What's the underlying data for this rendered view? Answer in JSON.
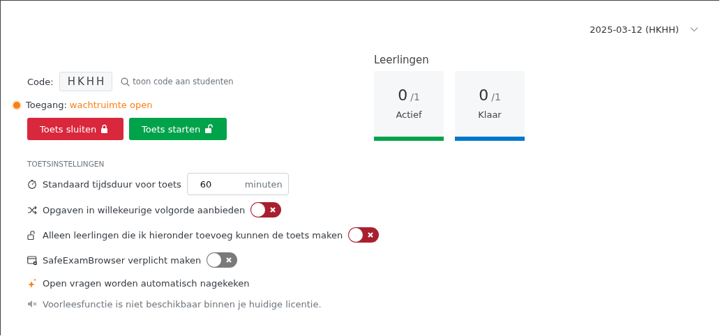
{
  "session_select": {
    "value": "2025-03-12 (HKHH)"
  },
  "code": {
    "label": "Code:",
    "value": "HKHH",
    "show_link": "toon code aan studenten"
  },
  "access": {
    "label": "Toegang:",
    "status": "wachtruimte open",
    "color": "#fd7e14"
  },
  "buttons": [
    {
      "label": "Toets sluiten",
      "kind": "close"
    },
    {
      "label": "Toets starten",
      "kind": "start"
    }
  ],
  "students": {
    "title": "Leerlingen",
    "cards": [
      {
        "count": "0",
        "total": "/1",
        "label": "Actief",
        "color": "#00a34a"
      },
      {
        "count": "0",
        "total": "/1",
        "label": "Klaar",
        "color": "#0077cc"
      }
    ]
  },
  "settings": {
    "heading": "TOETSINSTELLINGEN",
    "items": [
      {
        "kind": "duration",
        "label": "Standaard tijdsduur voor toets",
        "value": "60",
        "unit": "minuten"
      },
      {
        "kind": "toggle",
        "label": "Opgaven in willekeurige volgorde aanbieden",
        "on": false,
        "disabled": false
      },
      {
        "kind": "toggle",
        "label": "Alleen leerlingen die ik hieronder toevoeg kunnen de toets maken",
        "on": false,
        "disabled": false
      },
      {
        "kind": "toggle",
        "label": "SafeExamBrowser verplicht maken",
        "on": false,
        "disabled": true
      },
      {
        "kind": "info",
        "label": "Open vragen worden automatisch nagekeken"
      },
      {
        "kind": "notice",
        "label": "Voorleesfunctie is niet beschikbaar binnen je huidige licentie."
      }
    ]
  }
}
